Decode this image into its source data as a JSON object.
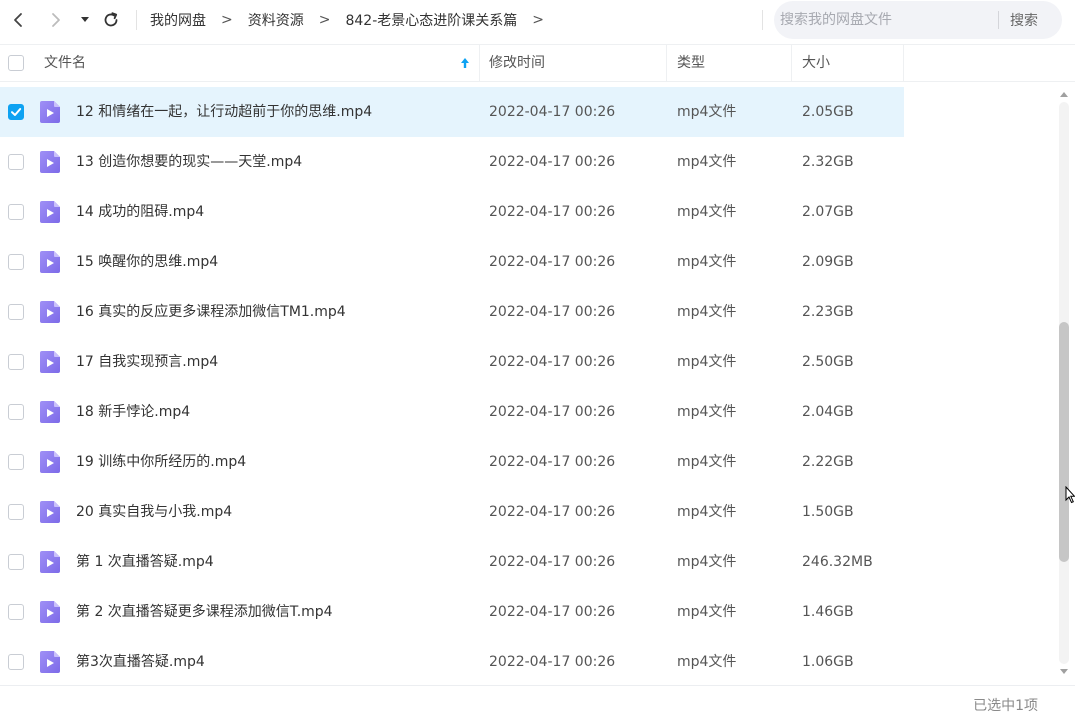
{
  "nav": {
    "breadcrumb": [
      "我的网盘",
      "资料资源",
      "842-老景心态进阶课关系篇"
    ],
    "separator": ">"
  },
  "search": {
    "placeholder": "搜索我的网盘文件",
    "button_label": "搜索"
  },
  "table": {
    "columns": {
      "name": "文件名",
      "modified": "修改时间",
      "type": "类型",
      "size": "大小"
    },
    "sort": {
      "column": "name",
      "direction": "ascending"
    },
    "rows": [
      {
        "name": "12 和情绪在一起，让行动超前于你的思维.mp4",
        "modified": "2022-04-17 00:26",
        "type": "mp4文件",
        "size": "2.05GB",
        "checked": true
      },
      {
        "name": "13 创造你想要的现实——天堂.mp4",
        "modified": "2022-04-17 00:26",
        "type": "mp4文件",
        "size": "2.32GB",
        "checked": false
      },
      {
        "name": "14 成功的阻碍.mp4",
        "modified": "2022-04-17 00:26",
        "type": "mp4文件",
        "size": "2.07GB",
        "checked": false
      },
      {
        "name": "15 唤醒你的思维.mp4",
        "modified": "2022-04-17 00:26",
        "type": "mp4文件",
        "size": "2.09GB",
        "checked": false
      },
      {
        "name": "16 真实的反应更多课程添加微信TM1.mp4",
        "modified": "2022-04-17 00:26",
        "type": "mp4文件",
        "size": "2.23GB",
        "checked": false
      },
      {
        "name": "17 自我实现预言.mp4",
        "modified": "2022-04-17 00:26",
        "type": "mp4文件",
        "size": "2.50GB",
        "checked": false
      },
      {
        "name": "18 新手悖论.mp4",
        "modified": "2022-04-17 00:26",
        "type": "mp4文件",
        "size": "2.04GB",
        "checked": false
      },
      {
        "name": "19 训练中你所经历的.mp4",
        "modified": "2022-04-17 00:26",
        "type": "mp4文件",
        "size": "2.22GB",
        "checked": false
      },
      {
        "name": "20 真实自我与小我.mp4",
        "modified": "2022-04-17 00:26",
        "type": "mp4文件",
        "size": "1.50GB",
        "checked": false
      },
      {
        "name": "第 1 次直播答疑.mp4",
        "modified": "2022-04-17 00:26",
        "type": "mp4文件",
        "size": "246.32MB",
        "checked": false
      },
      {
        "name": "第 2 次直播答疑更多课程添加微信T.mp4",
        "modified": "2022-04-17 00:26",
        "type": "mp4文件",
        "size": "1.46GB",
        "checked": false
      },
      {
        "name": "第3次直播答疑.mp4",
        "modified": "2022-04-17 00:26",
        "type": "mp4文件",
        "size": "1.06GB",
        "checked": false
      }
    ]
  },
  "status": {
    "selection_text": "已选中1项"
  },
  "icons": {
    "back": "chevron-left-icon",
    "forward": "chevron-right-icon",
    "history": "caret-down-icon",
    "refresh": "refresh-icon",
    "sort": "arrow-up-icon",
    "file": "video-file-icon",
    "checkbox": "checkbox-icon"
  },
  "colors": {
    "accent": "#0ea2f2",
    "selected_row": "#e5f4fd",
    "video_icon": "#8c7cf0",
    "search_bg": "#f2f3f7"
  }
}
